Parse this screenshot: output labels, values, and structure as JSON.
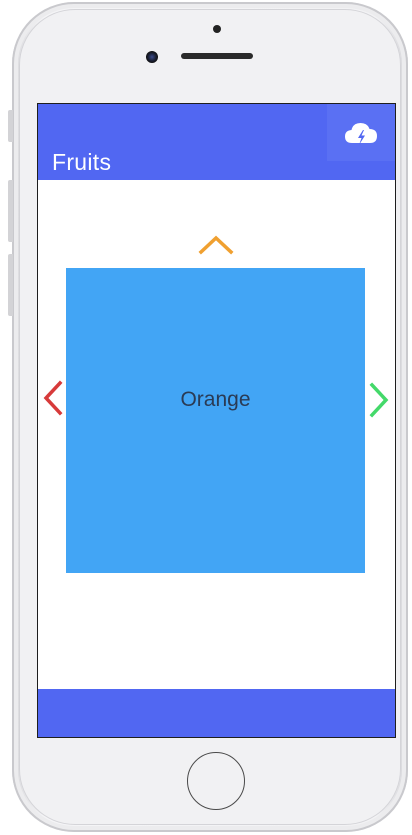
{
  "app": {
    "title": "Fruits"
  },
  "carousel": {
    "current_item": "Orange"
  },
  "icons": {
    "header_action": "cloud-lightning-icon",
    "up": "chevron-up-icon",
    "left": "chevron-left-icon",
    "right": "chevron-right-icon"
  },
  "colors": {
    "header": "#5167f2",
    "card": "#42a5f5",
    "arrow_up": "#f0a030",
    "arrow_left": "#d73a3a",
    "arrow_right": "#44d96a"
  }
}
